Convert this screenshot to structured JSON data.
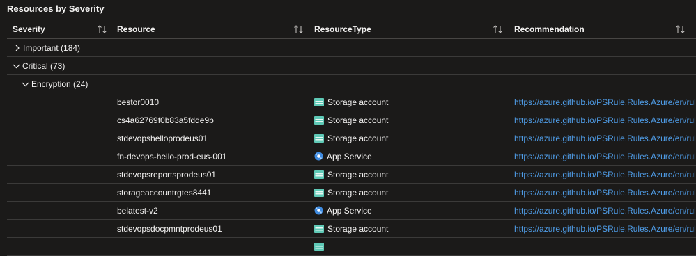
{
  "page_title": "Resources by Severity",
  "columns": [
    {
      "label": "Severity"
    },
    {
      "label": "Resource"
    },
    {
      "label": "ResourceType"
    },
    {
      "label": "Recommendation"
    }
  ],
  "groups": [
    {
      "label": "Important (184)",
      "expanded": false,
      "icon": "chevron-right-icon"
    },
    {
      "label": "Critical (73)",
      "expanded": true,
      "icon": "chevron-down-icon"
    },
    {
      "label": "Encryption (24)",
      "expanded": true,
      "icon": "chevron-down-icon"
    }
  ],
  "rows": [
    {
      "resource": "bestor0010",
      "type": "Storage account",
      "icon": "storage-account-icon",
      "recommendation": "https://azure.github.io/PSRule.Rules.Azure/en/rules/Azure"
    },
    {
      "resource": "cs4a62769f0b83a5fdde9b",
      "type": "Storage account",
      "icon": "storage-account-icon",
      "recommendation": "https://azure.github.io/PSRule.Rules.Azure/en/rules/Azure"
    },
    {
      "resource": "stdevopshelloprodeus01",
      "type": "Storage account",
      "icon": "storage-account-icon",
      "recommendation": "https://azure.github.io/PSRule.Rules.Azure/en/rules/Azure"
    },
    {
      "resource": "fn-devops-hello-prod-eus-001",
      "type": "App Service",
      "icon": "app-service-icon",
      "recommendation": "https://azure.github.io/PSRule.Rules.Azure/en/rules/Azure"
    },
    {
      "resource": "stdevopsreportsprodeus01",
      "type": "Storage account",
      "icon": "storage-account-icon",
      "recommendation": "https://azure.github.io/PSRule.Rules.Azure/en/rules/Azure"
    },
    {
      "resource": "storageaccountrgtes8441",
      "type": "Storage account",
      "icon": "storage-account-icon",
      "recommendation": "https://azure.github.io/PSRule.Rules.Azure/en/rules/Azure"
    },
    {
      "resource": "belatest-v2",
      "type": "App Service",
      "icon": "app-service-icon",
      "recommendation": "https://azure.github.io/PSRule.Rules.Azure/en/rules/Azure"
    },
    {
      "resource": "stdevopsdocpmntprodeus01",
      "type": "Storage account",
      "icon": "storage-account-icon",
      "recommendation": "https://azure.github.io/PSRule.Rules.Azure/en/rules/Azure"
    }
  ],
  "colors": {
    "background": "#1b1a19",
    "text": "#f3f2f1",
    "link": "#4f9de8",
    "row_border": "#3b3a39",
    "storage_icon": "#5fc9b6",
    "app_service_icon": "#3f8be0"
  }
}
